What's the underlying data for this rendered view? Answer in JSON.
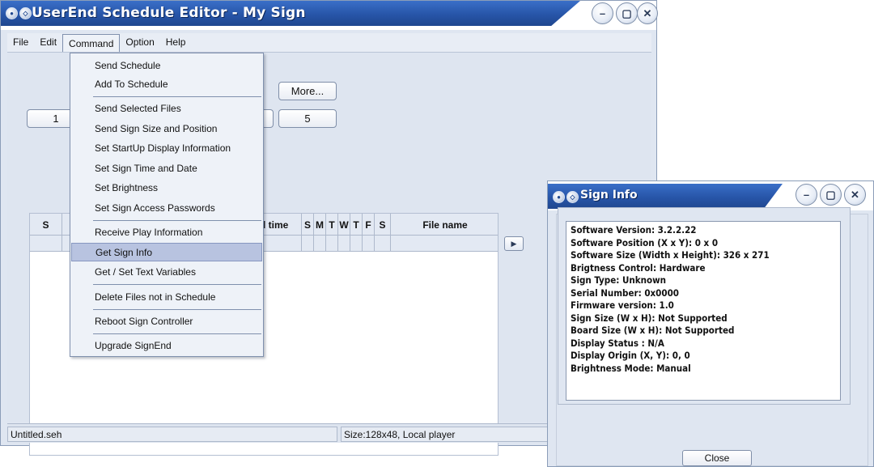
{
  "main_window": {
    "title": "UserEnd Schedule Editor - My Sign",
    "menu": {
      "file": "File",
      "edit": "Edit",
      "command": "Command",
      "option": "Option",
      "help": "Help"
    },
    "buttons": {
      "more": "More...",
      "btn1": "1",
      "btn5": "5"
    },
    "table": {
      "headers": [
        "S",
        "l time",
        "S",
        "M",
        "T",
        "W",
        "T",
        "F",
        "S",
        "File name"
      ]
    },
    "status": {
      "file": "Untitled.seh",
      "size": "Size:128x48, Local player"
    }
  },
  "command_menu": {
    "items": [
      "Send Schedule",
      "Add To Schedule",
      "Send Selected Files",
      "Send Sign Size and Position",
      "Set StartUp Display Information",
      "Set Sign Time and Date",
      "Set Brightness",
      "Set Sign Access Passwords",
      "Receive Play Information",
      "Get Sign Info",
      "Get / Set Text Variables",
      "Delete Files not in Schedule",
      "Reboot Sign Controller",
      "Upgrade SignEnd"
    ],
    "highlighted": "Get Sign Info"
  },
  "sign_info": {
    "title": "Sign Info",
    "lines": [
      "Software Version: 3.2.2.22",
      "Software Position (X x Y): 0 x 0",
      "Software Size (Width x Height): 326 x 271",
      "Brigtness Control: Hardware",
      "Sign Type: Unknown",
      "Serial Number: 0x0000",
      "Firmware version: 1.0",
      "Sign Size (W x H): Not Supported",
      "Board Size (W x H): Not Supported",
      "Display Status : N/A",
      "Display Origin (X, Y): 0, 0",
      "Brightness Mode: Manual"
    ],
    "close": "Close"
  },
  "icons": {
    "window_buttons": [
      "minimize-icon",
      "maximize-icon",
      "close-icon"
    ],
    "title_dots": [
      "system-menu-icon",
      "rollup-icon"
    ]
  }
}
